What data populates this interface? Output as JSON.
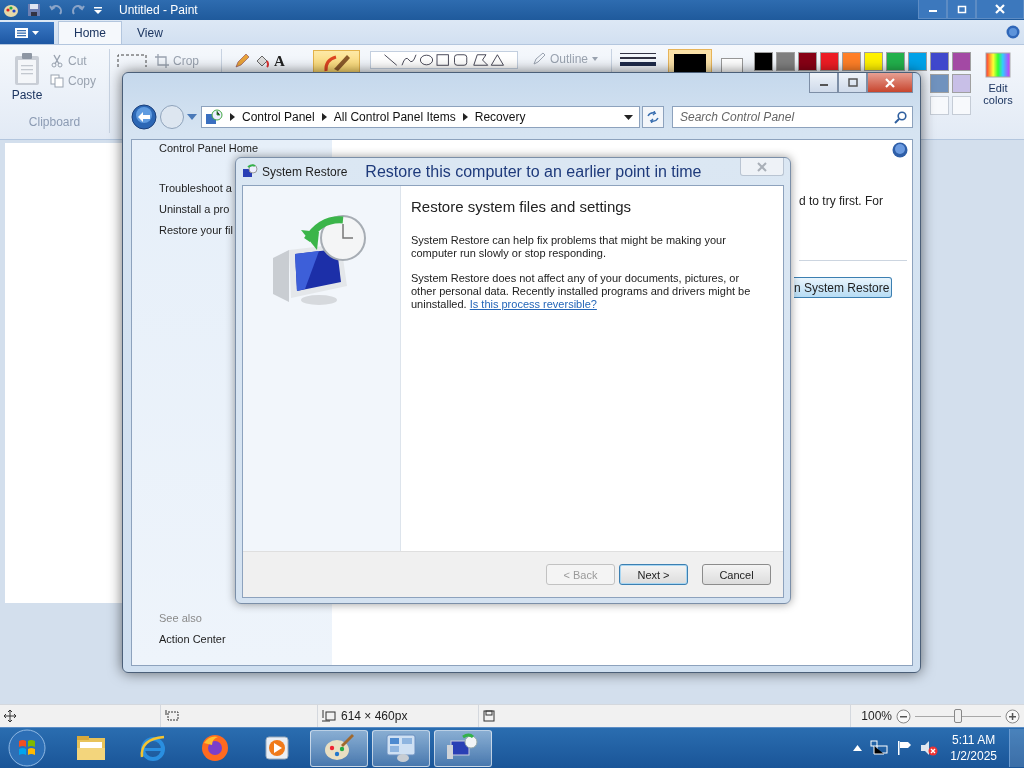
{
  "paint": {
    "title": "Untitled - Paint",
    "tabs": [
      {
        "label": "Home",
        "selected": true
      },
      {
        "label": "View",
        "selected": false
      }
    ],
    "clipboard": {
      "paste": "Paste",
      "cut": "Cut",
      "copy": "Copy",
      "label": "Clipboard"
    },
    "image": {
      "crop": "Crop"
    },
    "text_tool": "A",
    "brushes": {
      "selected": true
    },
    "outline": "Outline",
    "color1": {
      "color": "#000000",
      "selected": true
    },
    "color2": {
      "color": "#ffffff",
      "selected": false
    },
    "palette": [
      {
        "color": "#000000"
      },
      {
        "color": "#7f7f7f"
      },
      {
        "color": "#880015"
      },
      {
        "color": "#ed1c24"
      },
      {
        "color": "#ff7f27"
      },
      {
        "color": "#fff200"
      },
      {
        "color": "#22b14c"
      },
      {
        "color": "#00a2e8"
      },
      {
        "color": "#3f48cc"
      },
      {
        "color": "#a349a4"
      }
    ],
    "palette_row2": [
      {
        "color": "#7092be"
      },
      {
        "color": "#c8bfe7"
      }
    ],
    "edit_colors": "Edit colors",
    "status": {
      "size": "614 × 460px",
      "zoom": "100%",
      "zoom_slider": {
        "level": 0.5
      }
    }
  },
  "control_panel": {
    "breadcrumb": [
      "Control Panel",
      "All Control Panel Items",
      "Recovery"
    ],
    "search_placeholder": "Search Control Panel",
    "nav": [
      {
        "label": "Control Panel Home"
      },
      {
        "label": "Troubleshoot a"
      },
      {
        "label": "Uninstall a pro"
      },
      {
        "label": "Restore your fil"
      }
    ],
    "see_also": "See also",
    "see_also_links": [
      "Action Center"
    ],
    "intro_tail": "d to try first. For",
    "open_button_tail": "n System Restore"
  },
  "system_restore": {
    "title": "System Restore",
    "heading": "Restore this computer to an earlier point in time",
    "section_title": "Restore system files and settings",
    "paragraph_1": "System Restore can help fix problems that might be making your computer run slowly or stop responding.",
    "paragraph_2": "System Restore does not affect any of your documents, pictures, or other personal data. Recently installed programs and drivers might be uninstalled.",
    "link": "Is this process reversible?",
    "buttons": [
      {
        "label": "< Back",
        "disabled": true,
        "default": false
      },
      {
        "label": "Next >",
        "disabled": false,
        "default": true
      },
      {
        "label": "Cancel",
        "disabled": false,
        "default": false
      }
    ]
  },
  "taskbar": {
    "apps": [
      {
        "kind": "explorer",
        "active": false
      },
      {
        "kind": "browser",
        "active": false
      },
      {
        "kind": "firefox",
        "active": false
      },
      {
        "kind": "media",
        "active": false
      },
      {
        "kind": "paint",
        "active": true
      },
      {
        "kind": "control_panel",
        "active": true
      },
      {
        "kind": "restore",
        "active": true
      }
    ],
    "time": "5:11 AM",
    "date": "1/2/2025"
  }
}
